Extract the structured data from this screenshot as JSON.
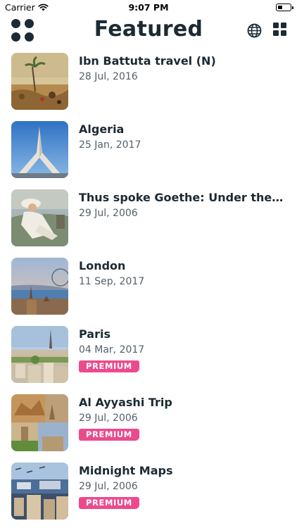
{
  "status_bar": {
    "carrier": "Carrier",
    "time": "9:07 PM"
  },
  "header": {
    "title": "Featured",
    "icons": [
      "menu-dots-icon",
      "globe-icon",
      "grid-icon"
    ]
  },
  "list": {
    "badge_label": "PREMIUM",
    "items": [
      {
        "title": "Ibn Battuta travel (N)",
        "date": "28 Jul, 2016",
        "premium": false
      },
      {
        "title": "Algeria",
        "date": "25 Jan, 2017",
        "premium": false
      },
      {
        "title": "Thus spoke Goethe: Under the sk...",
        "date": "29 Jul, 2006",
        "premium": false
      },
      {
        "title": "London",
        "date": "11 Sep, 2017",
        "premium": false
      },
      {
        "title": "Paris",
        "date": "04 Mar, 2017",
        "premium": true
      },
      {
        "title": "Al Ayyashi Trip",
        "date": "29 Jul, 2006",
        "premium": true
      },
      {
        "title": "Midnight Maps",
        "date": "29 Jul, 2006",
        "premium": true
      }
    ]
  },
  "colors": {
    "text": "#1c2a33",
    "subtext": "#54606a",
    "premium_badge": "#ec4a8d"
  }
}
